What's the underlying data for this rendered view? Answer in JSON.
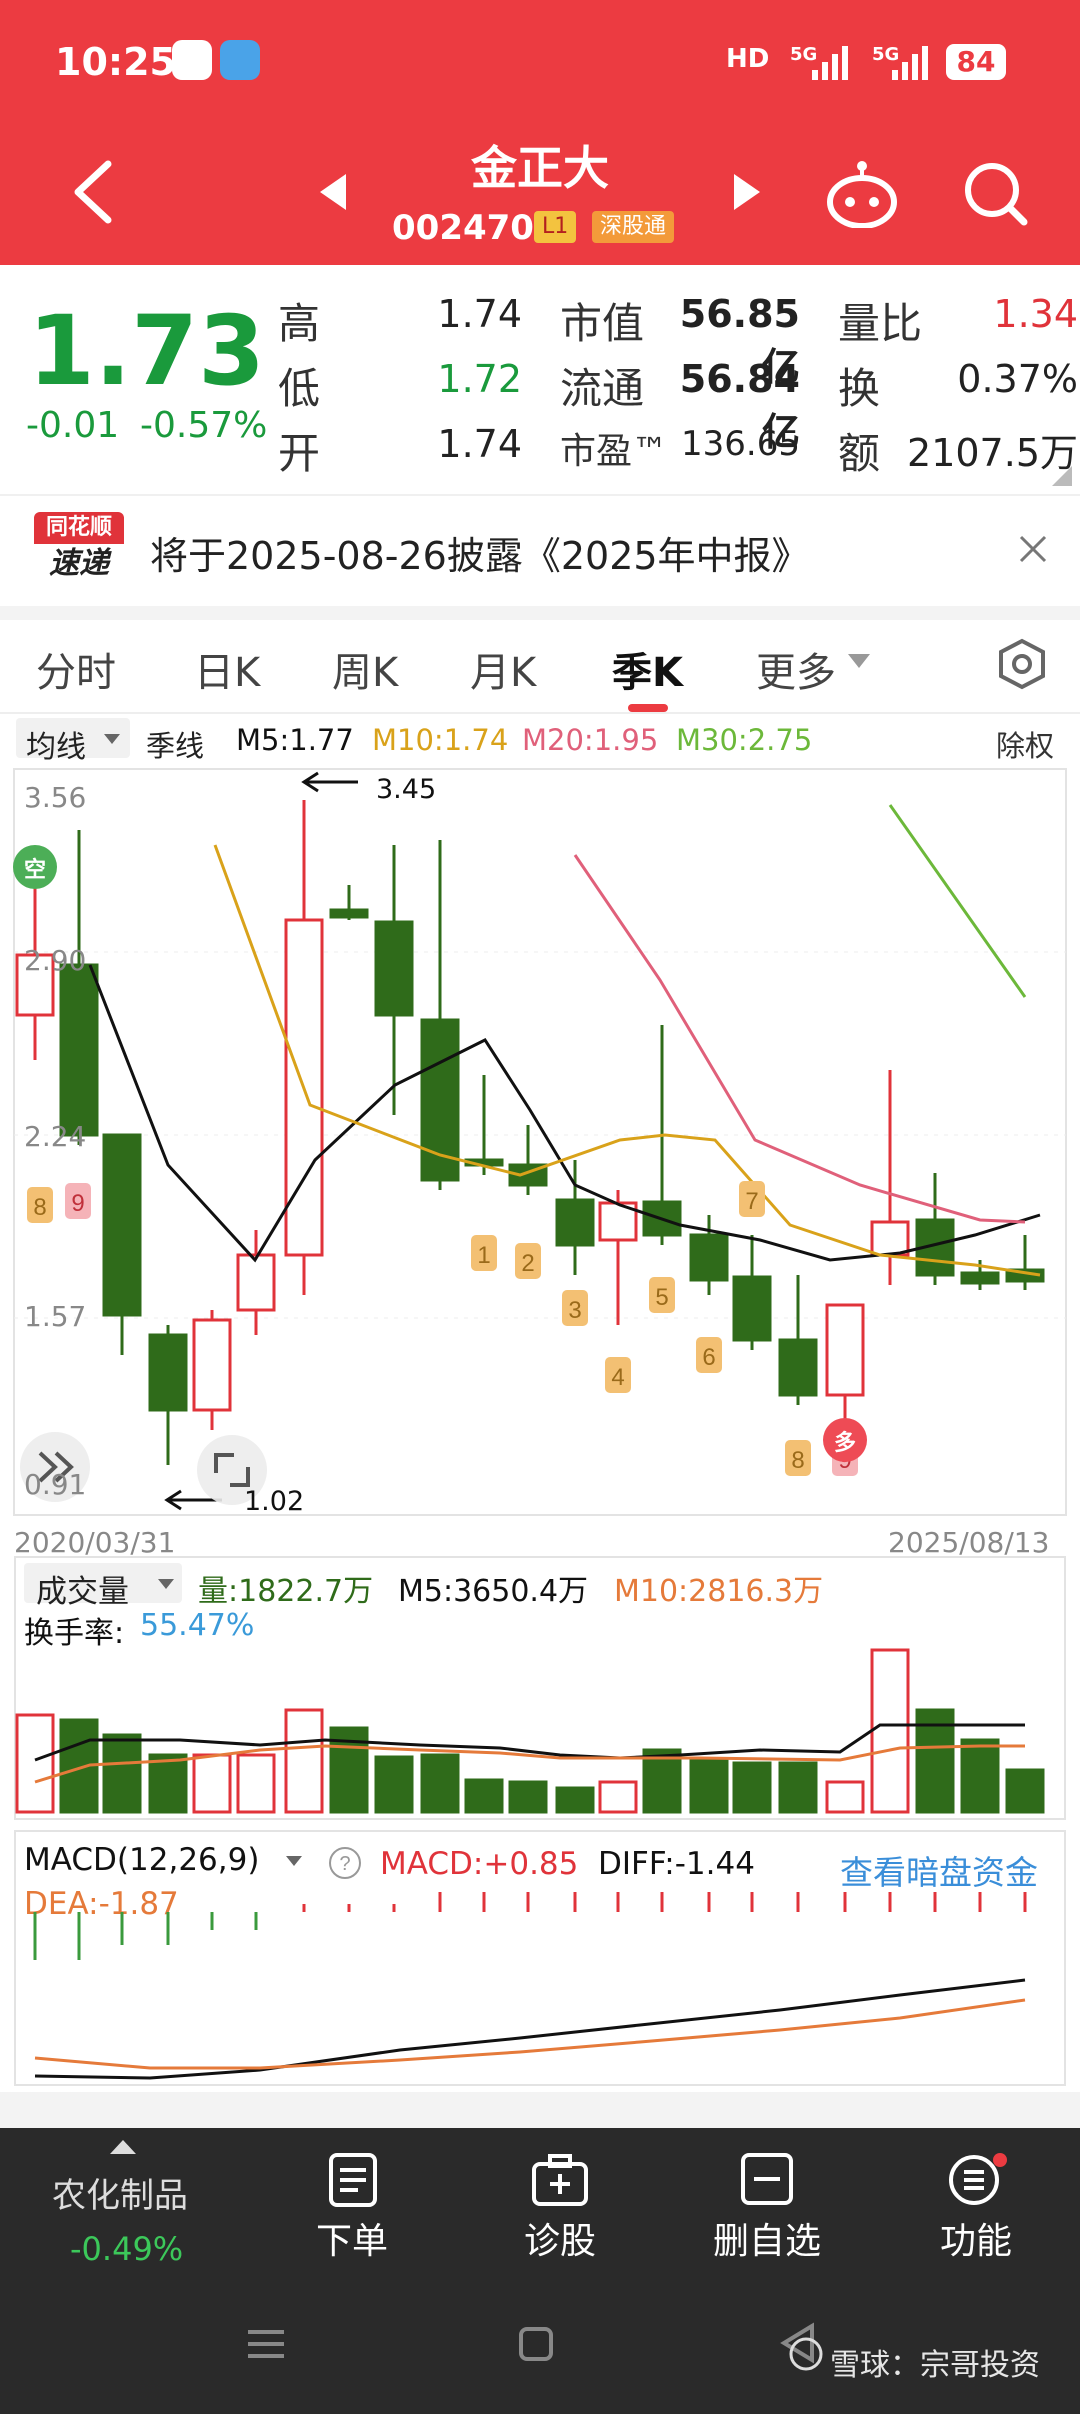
{
  "status_bar": {
    "time": "10:25",
    "hd": "HD",
    "net1": "5G",
    "net2": "5G",
    "battery": "84"
  },
  "header": {
    "title": "金正大",
    "code": "002470",
    "level_tag": "L1",
    "market_tag": "深股通"
  },
  "quote": {
    "price": "1.73",
    "change": "-0.01",
    "change_pct": "-0.57%",
    "fields": [
      {
        "label": "高",
        "value": "1.74",
        "color": "black"
      },
      {
        "label": "低",
        "value": "1.72",
        "color": "green"
      },
      {
        "label": "开",
        "value": "1.74",
        "color": "black"
      }
    ],
    "mid": [
      {
        "label": "市值",
        "value": "56.85亿"
      },
      {
        "label": "流通",
        "value": "56.84亿"
      },
      {
        "label": "市盈™",
        "value": "136.65"
      }
    ],
    "right": [
      {
        "label": "量比",
        "value": "1.34",
        "color": "red"
      },
      {
        "label": "换",
        "value": "0.37%",
        "color": "black"
      },
      {
        "label": "额",
        "value": "2107.5万",
        "color": "black"
      }
    ]
  },
  "notice": {
    "logo_line1": "同花顺",
    "logo_line2": "速递",
    "text": "将于2025-08-26披露《2025年中报》",
    "close_icon": "close-icon"
  },
  "tabs": [
    "分时",
    "日K",
    "周K",
    "月K",
    "季K",
    "更多"
  ],
  "active_tab": "季K",
  "kline_bar": {
    "ma_type": "均线",
    "period": "季线",
    "m5": "M5:1.77",
    "m10": "M10:1.74",
    "m20": "M20:1.95",
    "m30": "M30:2.75",
    "adjust": "除权"
  },
  "kline": {
    "y_labels": [
      "3.56",
      "2.90",
      "2.24",
      "1.57",
      "0.91"
    ],
    "date_start": "2020/03/31",
    "date_end": "2025/08/13",
    "high_annotation": "3.45",
    "low_annotation": "1.02",
    "badge_kong": "空",
    "badge_duo": "多"
  },
  "volume": {
    "title": "成交量",
    "vol": "量:1822.7万",
    "m5": "M5:3650.4万",
    "m10": "M10:2816.3万",
    "turnover_label": "换手率:",
    "turnover": "55.47%"
  },
  "macd": {
    "title": "MACD(12,26,9)",
    "macd": "MACD:+0.85",
    "diff": "DIFF:-1.44",
    "dea": "DEA:-1.87",
    "link": "查看暗盘资金"
  },
  "bottom_nav": {
    "sector": "农化制品",
    "sector_pct": "-0.49%",
    "items": [
      {
        "label": "下单"
      },
      {
        "label": "诊股"
      },
      {
        "label": "删自选"
      },
      {
        "label": "功能"
      }
    ]
  },
  "watermark": "雪球：宗哥投资",
  "colors": {
    "red": "#ec3b41",
    "up": "#e0333a",
    "down": "#2f6b1a",
    "ma5": "#111111",
    "ma10": "#d9a21a",
    "ma20": "#e0607a",
    "ma30": "#6cb83a"
  }
}
